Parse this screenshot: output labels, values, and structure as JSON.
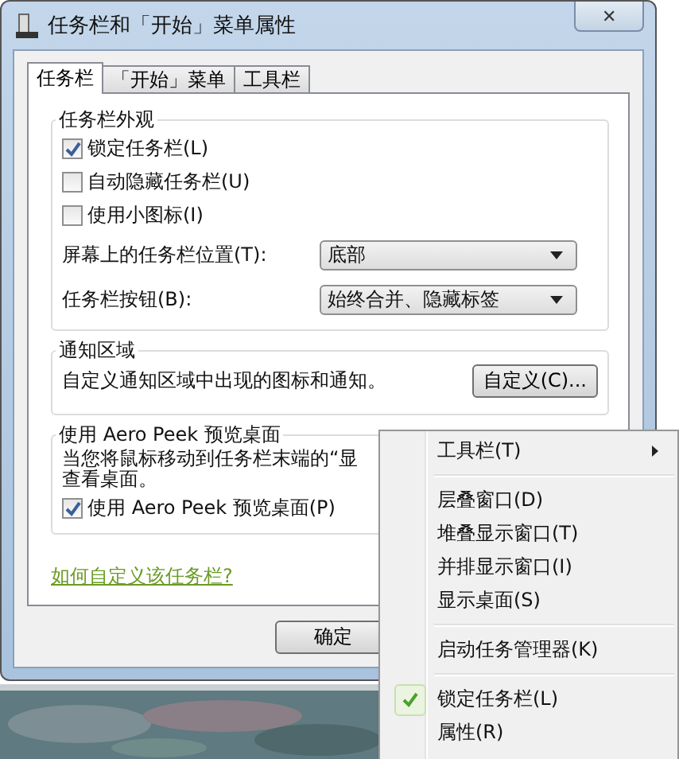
{
  "window": {
    "title": "任务栏和「开始」菜单属性",
    "close": "✕"
  },
  "tabs": [
    {
      "label": "任务栏",
      "selected": true
    },
    {
      "label": "「开始」菜单",
      "selected": false
    },
    {
      "label": "工具栏",
      "selected": false
    }
  ],
  "appearance": {
    "title": "任务栏外观",
    "checkboxes": [
      {
        "label": "锁定任务栏(L)",
        "checked": true
      },
      {
        "label": "自动隐藏任务栏(U)",
        "checked": false
      },
      {
        "label": "使用小图标(I)",
        "checked": false
      }
    ],
    "dropdowns": [
      {
        "label": "屏幕上的任务栏位置(T):",
        "value": "底部"
      },
      {
        "label": "任务栏按钮(B):",
        "value": "始终合并、隐藏标签"
      }
    ]
  },
  "notification": {
    "title": "通知区域",
    "text": "自定义通知区域中出现的图标和通知。",
    "button": "自定义(C)..."
  },
  "peek": {
    "title": "使用 Aero Peek 预览桌面",
    "text_lines": [
      "当您将鼠标移动到任务栏末端的“显",
      "查看桌面。"
    ],
    "checkbox": {
      "label": "使用 Aero Peek 预览桌面(P)",
      "checked": true
    }
  },
  "link": "如何自定义该任务栏?",
  "buttons": [
    "确定"
  ],
  "context_menu": {
    "groups": [
      [
        {
          "label": "工具栏(T)",
          "submenu": true,
          "checked": false
        }
      ],
      [
        {
          "label": "层叠窗口(D)",
          "submenu": false,
          "checked": false
        },
        {
          "label": "堆叠显示窗口(T)",
          "submenu": false,
          "checked": false
        },
        {
          "label": "并排显示窗口(I)",
          "submenu": false,
          "checked": false
        },
        {
          "label": "显示桌面(S)",
          "submenu": false,
          "checked": false
        }
      ],
      [
        {
          "label": "启动任务管理器(K)",
          "submenu": false,
          "checked": false
        }
      ],
      [
        {
          "label": "锁定任务栏(L)",
          "submenu": false,
          "checked": true
        },
        {
          "label": "属性(R)",
          "submenu": false,
          "checked": false
        }
      ]
    ]
  }
}
